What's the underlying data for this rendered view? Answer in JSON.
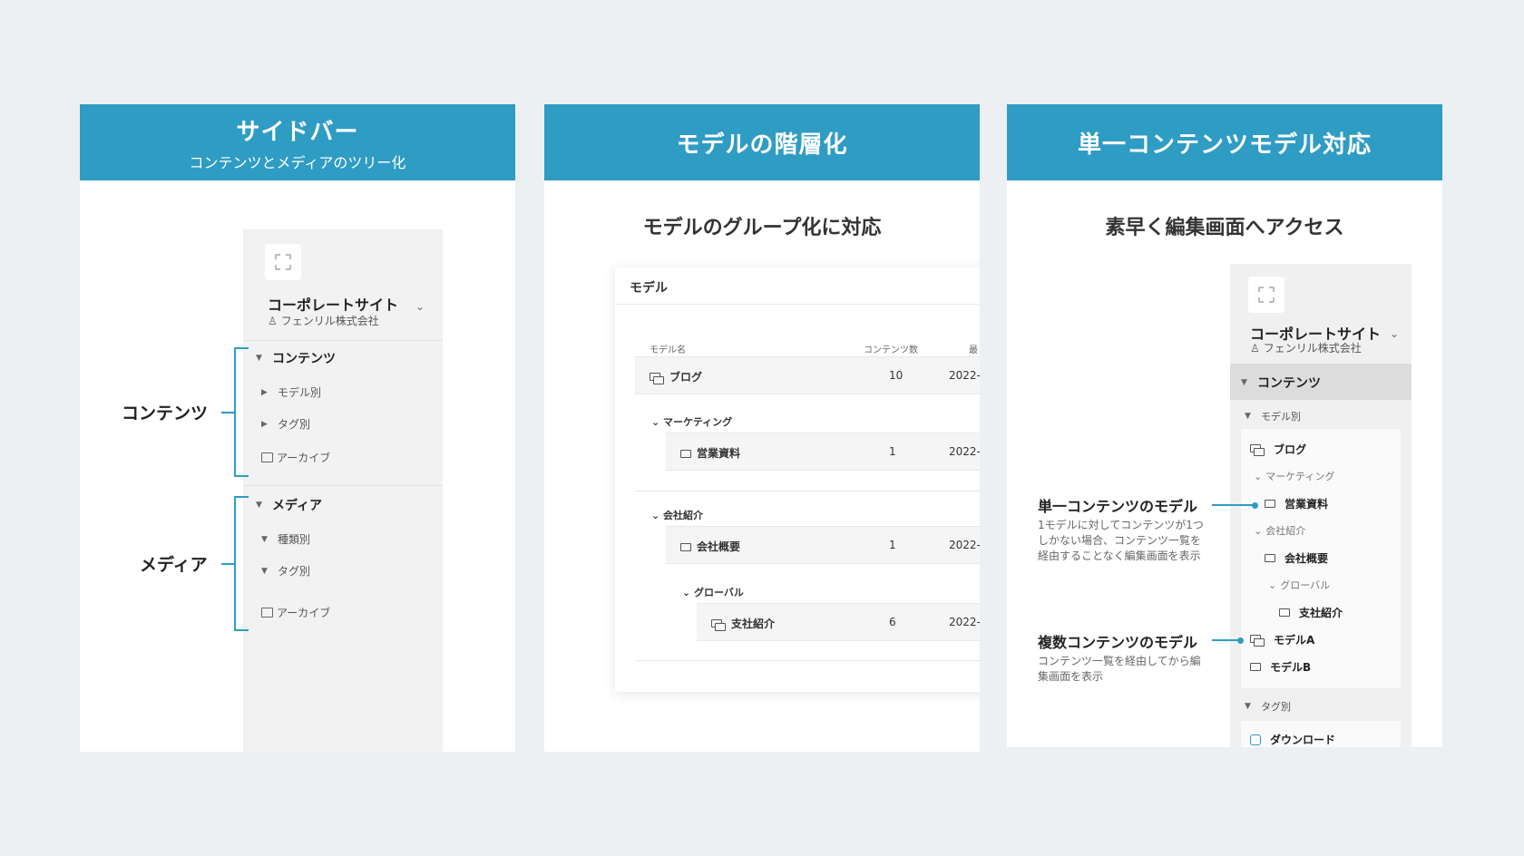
{
  "panel1": {
    "title": "サイドバー",
    "subtitle": "コンテンツとメディアのツリー化",
    "sidebar": {
      "site_name": "コーポレートサイト",
      "company": "フェンリル株式会社",
      "contents_section": "コンテンツ",
      "contents_items": [
        "モデル別",
        "タグ別",
        "アーカイブ"
      ],
      "media_section": "メディア",
      "media_items": [
        "種類別",
        "タグ別",
        "アーカイブ"
      ]
    },
    "labels": {
      "contents": "コンテンツ",
      "media": "メディア"
    }
  },
  "panel2": {
    "title": "モデルの階層化",
    "subtitle": "モデルのグループ化に対応",
    "card_title": "モデル",
    "headers": {
      "name": "モデル名",
      "count": "コンテンツ数",
      "updated": "最"
    },
    "rows": {
      "blog": {
        "name": "ブログ",
        "count": "10",
        "date": "2022-"
      },
      "group_marketing": "マーケティング",
      "sales": {
        "name": "営業資料",
        "count": "1",
        "date": "2022-"
      },
      "group_company": "会社紹介",
      "overview": {
        "name": "会社概要",
        "count": "1",
        "date": "2022-"
      },
      "group_global": "グローバル",
      "branch": {
        "name": "支社紹介",
        "count": "6",
        "date": "2022-"
      }
    }
  },
  "panel3": {
    "title": "単一コンテンツモデル対応",
    "subtitle": "素早く編集画面へアクセス",
    "sidebar": {
      "site_name": "コーポレートサイト",
      "company": "フェンリル株式会社",
      "contents": "コンテンツ",
      "by_model": "モデル別",
      "blog": "ブログ",
      "marketing": "マーケティング",
      "sales": "営業資料",
      "company_intro": "会社紹介",
      "overview": "会社概要",
      "global": "グローバル",
      "branch": "支社紹介",
      "model_a": "モデルA",
      "model_b": "モデルB",
      "by_tag": "タグ別",
      "download": "ダウンロード"
    },
    "annotations": {
      "single_title": "単一コンテンツのモデル",
      "single_desc": "1モデルに対してコンテンツが1つしかない場合、コンテンツ一覧を経由することなく編集画面を表示",
      "multi_title": "複数コンテンツのモデル",
      "multi_desc": "コンテンツ一覧を経由してから編集画面を表示"
    }
  },
  "colors": {
    "accent": "#2f9cc4",
    "background": "#ecf0f3"
  }
}
